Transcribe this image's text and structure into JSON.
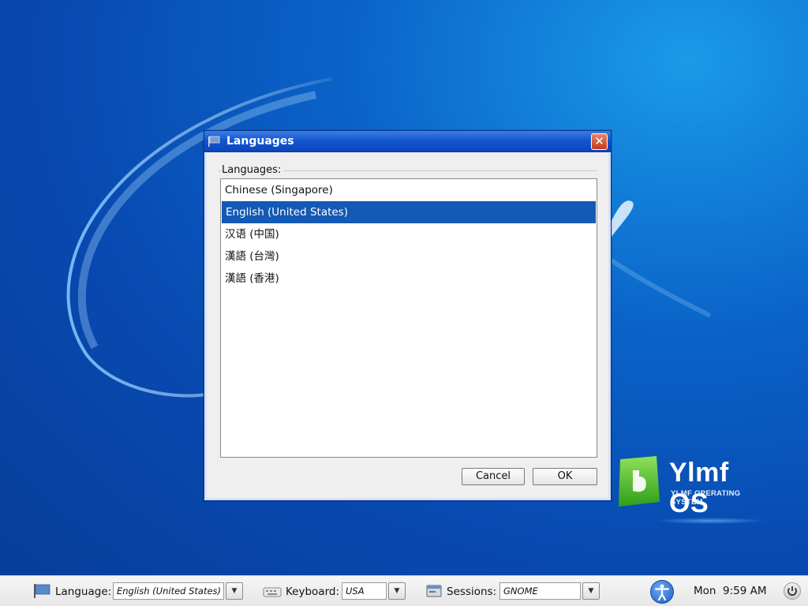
{
  "dialog": {
    "title": "Languages",
    "list_label": "Languages:",
    "items": [
      {
        "label": "Chinese (Singapore)",
        "selected": false
      },
      {
        "label": "English (United States)",
        "selected": true
      },
      {
        "label": "汉语 (中国)",
        "selected": false
      },
      {
        "label": "漢語 (台灣)",
        "selected": false
      },
      {
        "label": "漢語 (香港)",
        "selected": false
      }
    ],
    "cancel_label": "Cancel",
    "ok_label": "OK"
  },
  "logo": {
    "name": "Ylmf OS",
    "subtitle": "YLMF OPERATING SYSTEM"
  },
  "panel": {
    "language_label": "Language:",
    "language_value": "English (United States)",
    "keyboard_label": "Keyboard:",
    "keyboard_value": "USA",
    "sessions_label": "Sessions:",
    "sessions_value": "GNOME",
    "clock": "Mon  9:59 AM"
  },
  "colors": {
    "titlebar": "#1556cf",
    "selection": "#1359b5",
    "desktop": "#0a63c8"
  }
}
